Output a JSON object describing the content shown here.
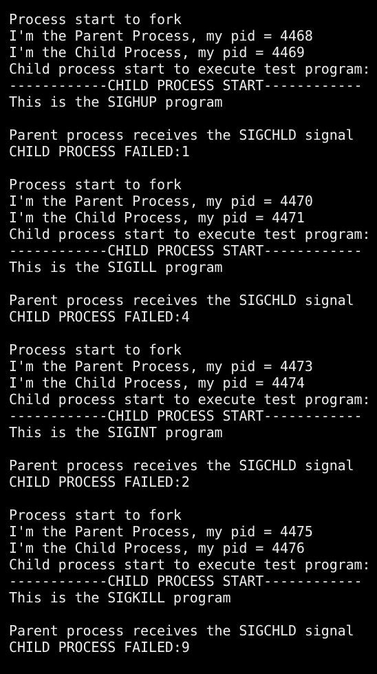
{
  "terminal": {
    "background": "#000000",
    "foreground": "#ececec",
    "lines": [
      "Process start to fork",
      "I'm the Parent Process, my pid = 4468",
      "I'm the Child Process, my pid = 4469",
      "Child process start to execute test program:",
      "------------CHILD PROCESS START------------",
      "This is the SIGHUP program",
      "",
      "Parent process receives the SIGCHLD signal",
      "CHILD PROCESS FAILED:1",
      "",
      "Process start to fork",
      "I'm the Parent Process, my pid = 4470",
      "I'm the Child Process, my pid = 4471",
      "Child process start to execute test program:",
      "------------CHILD PROCESS START------------",
      "This is the SIGILL program",
      "",
      "Parent process receives the SIGCHLD signal",
      "CHILD PROCESS FAILED:4",
      "",
      "Process start to fork",
      "I'm the Parent Process, my pid = 4473",
      "I'm the Child Process, my pid = 4474",
      "Child process start to execute test program:",
      "------------CHILD PROCESS START------------",
      "This is the SIGINT program",
      "",
      "Parent process receives the SIGCHLD signal",
      "CHILD PROCESS FAILED:2",
      "",
      "Process start to fork",
      "I'm the Parent Process, my pid = 4475",
      "I'm the Child Process, my pid = 4476",
      "Child process start to execute test program:",
      "------------CHILD PROCESS START------------",
      "This is the SIGKILL program",
      "",
      "Parent process receives the SIGCHLD signal",
      "CHILD PROCESS FAILED:9"
    ]
  }
}
